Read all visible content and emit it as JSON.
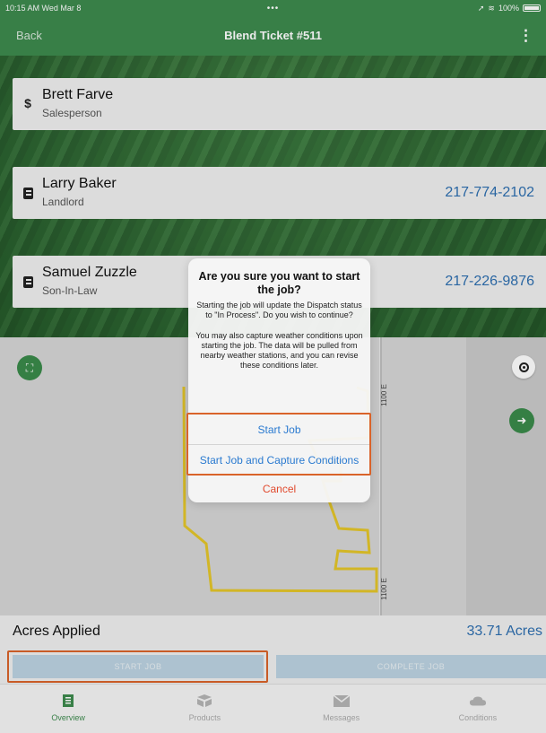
{
  "status": {
    "time": "10:15 AM  Wed Mar 8",
    "dots": "•••",
    "battery": "100%"
  },
  "nav": {
    "back": "Back",
    "title": "Blend Ticket #511",
    "more": "⋮"
  },
  "contacts": [
    {
      "name": "Brett Farve",
      "role": "Salesperson",
      "phone": "",
      "icon": "dollar-icon"
    },
    {
      "name": "Larry Baker",
      "role": "Landlord",
      "phone": "217-774-2102",
      "icon": "contact-book-icon"
    },
    {
      "name": "Samuel Zuzzle",
      "role": "Son-In-Law",
      "phone": "217-226-9876",
      "icon": "contact-book-icon"
    }
  ],
  "map": {
    "road_label_top": "1100 E",
    "road_label_bottom": "1100 E",
    "field_outline_color": "#e4c62a"
  },
  "acres": {
    "label": "Acres Applied",
    "value": "33.71 Acres"
  },
  "job_buttons": {
    "start": "START JOB",
    "complete": "COMPLETE JOB"
  },
  "tabs": [
    {
      "label": "Overview",
      "icon": "overview-icon",
      "active": true
    },
    {
      "label": "Products",
      "icon": "products-icon",
      "active": false
    },
    {
      "label": "Messages",
      "icon": "messages-icon",
      "active": false
    },
    {
      "label": "Conditions",
      "icon": "conditions-icon",
      "active": false
    }
  ],
  "dialog": {
    "title": "Are you sure you want to start the job?",
    "message": "Starting the job will update the Dispatch status to \"In Process\". Do you wish to continue?\n\nYou may also capture weather conditions upon starting the job.  The data will be pulled from nearby weather stations, and you can revise these conditions later.",
    "buttons": {
      "start_job": "Start Job",
      "start_capture": "Start Job and Capture Conditions",
      "cancel": "Cancel"
    }
  },
  "colors": {
    "nav_green": "#3d8a4e",
    "link_blue": "#2e6fb0",
    "highlight_orange": "#d9632a",
    "cancel_red": "#e14a2e"
  }
}
